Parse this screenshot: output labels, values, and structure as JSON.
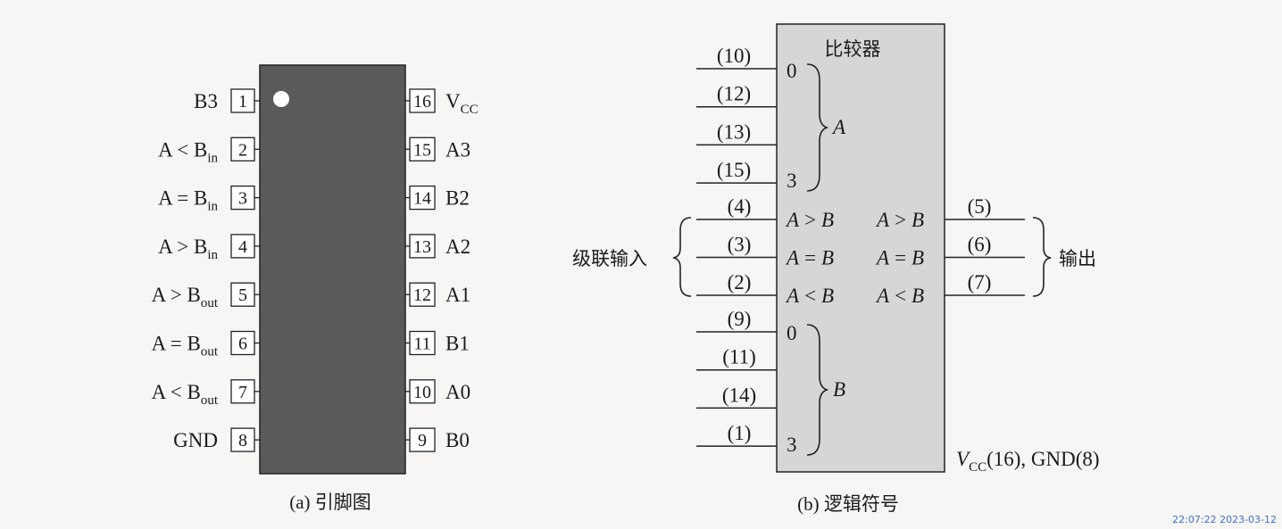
{
  "pinout": {
    "caption": "(a) 引脚图",
    "left_pins": [
      {
        "num": "1",
        "name": "B3"
      },
      {
        "num": "2",
        "name": "A < B",
        "sub": "in"
      },
      {
        "num": "3",
        "name": "A = B",
        "sub": "in"
      },
      {
        "num": "4",
        "name": "A > B",
        "sub": "in"
      },
      {
        "num": "5",
        "name": "A > B",
        "sub": "out"
      },
      {
        "num": "6",
        "name": "A = B",
        "sub": "out"
      },
      {
        "num": "7",
        "name": "A < B",
        "sub": "out"
      },
      {
        "num": "8",
        "name": "GND"
      }
    ],
    "right_pins": [
      {
        "num": "16",
        "name": "V",
        "sub": "CC"
      },
      {
        "num": "15",
        "name": "A3"
      },
      {
        "num": "14",
        "name": "B2"
      },
      {
        "num": "13",
        "name": "A2"
      },
      {
        "num": "12",
        "name": "A1"
      },
      {
        "num": "11",
        "name": "B1"
      },
      {
        "num": "10",
        "name": "A0"
      },
      {
        "num": "9",
        "name": "B0"
      }
    ]
  },
  "logic_symbol": {
    "caption": "(b) 逻辑符号",
    "title": "比较器",
    "a_inputs": [
      "(10)",
      "(12)",
      "(13)",
      "(15)"
    ],
    "a_bit_start": "0",
    "a_bit_end": "3",
    "a_group": "A",
    "cascade_label": "级联输入",
    "cascade_inputs": [
      {
        "pin": "(4)",
        "label": "A > B"
      },
      {
        "pin": "(3)",
        "label": "A = B"
      },
      {
        "pin": "(2)",
        "label": "A < B"
      }
    ],
    "outputs": [
      {
        "pin": "(5)",
        "label": "A > B"
      },
      {
        "pin": "(6)",
        "label": "A = B"
      },
      {
        "pin": "(7)",
        "label": "A < B"
      }
    ],
    "output_label": "输出",
    "b_inputs": [
      "(9)",
      "(11)",
      "(14)",
      "(1)"
    ],
    "b_bit_start": "0",
    "b_bit_end": "3",
    "b_group": "B",
    "power_v": "V",
    "power_sub": "CC",
    "power_rest": "(16), GND(8)"
  },
  "timestamp": "22:07:22 2023-03-12",
  "colors": {
    "ic_body": "#5a5a5a",
    "symbol_fill": "#d6d6d6",
    "stamp": "#3b6fd6"
  }
}
